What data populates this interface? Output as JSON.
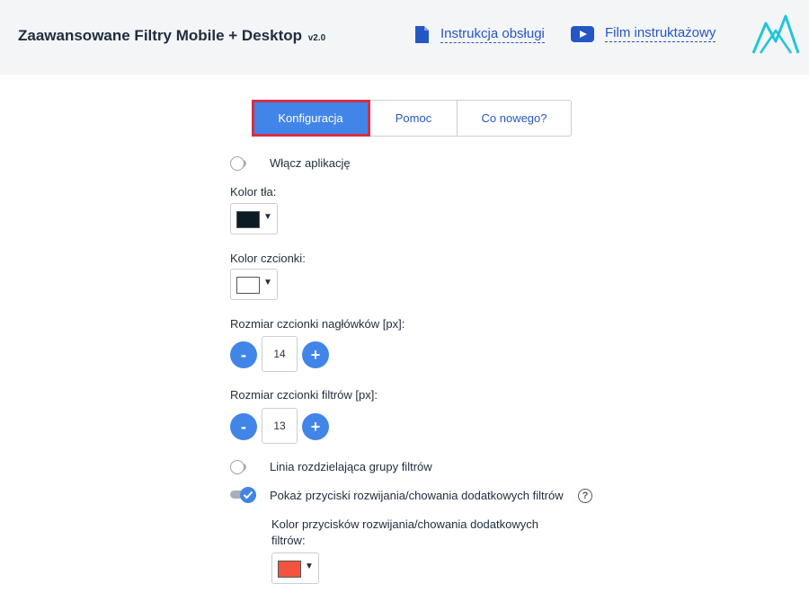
{
  "header": {
    "title": "Zaawansowane Filtry Mobile + Desktop",
    "version": "v2.0",
    "manual_link": "Instrukcja obsługi",
    "video_link": "Film instruktażowy",
    "manual_icon": "document-icon",
    "video_icon": "youtube-play-icon",
    "logo_icon": "app-logo-icon"
  },
  "tabs": [
    {
      "label": "Konfiguracja",
      "active": true
    },
    {
      "label": "Pomoc",
      "active": false
    },
    {
      "label": "Co nowego?",
      "active": false
    }
  ],
  "settings": {
    "enable_app": {
      "label": "Włącz aplikację",
      "enabled": false
    },
    "bg_color": {
      "label": "Kolor tła:",
      "value": "#0d1b26"
    },
    "font_color": {
      "label": "Kolor czcionki:",
      "value": "#ffffff"
    },
    "header_font_size": {
      "label": "Rozmiar czcionki nagłówków [px]:",
      "value": "14",
      "minus": "-",
      "plus": "+"
    },
    "filter_font_size": {
      "label": "Rozmiar czcionki filtrów [px]:",
      "value": "13",
      "minus": "-",
      "plus": "+"
    },
    "separator_line": {
      "label": "Linia rozdzielająca grupy filtrów",
      "enabled": false
    },
    "expand_buttons": {
      "label": "Pokaż przyciski rozwijania/chowania dodatkowych filtrów",
      "enabled": true,
      "help": "?"
    },
    "expand_buttons_color": {
      "label": "Kolor przycisków rozwijania/chowania dodatkowych filtrów:",
      "value": "#f4533d"
    }
  },
  "colors": {
    "accent": "#4285e8",
    "active_tab_border": "#d32f45",
    "link": "#2557c4",
    "logo": "#1fc6d6"
  }
}
